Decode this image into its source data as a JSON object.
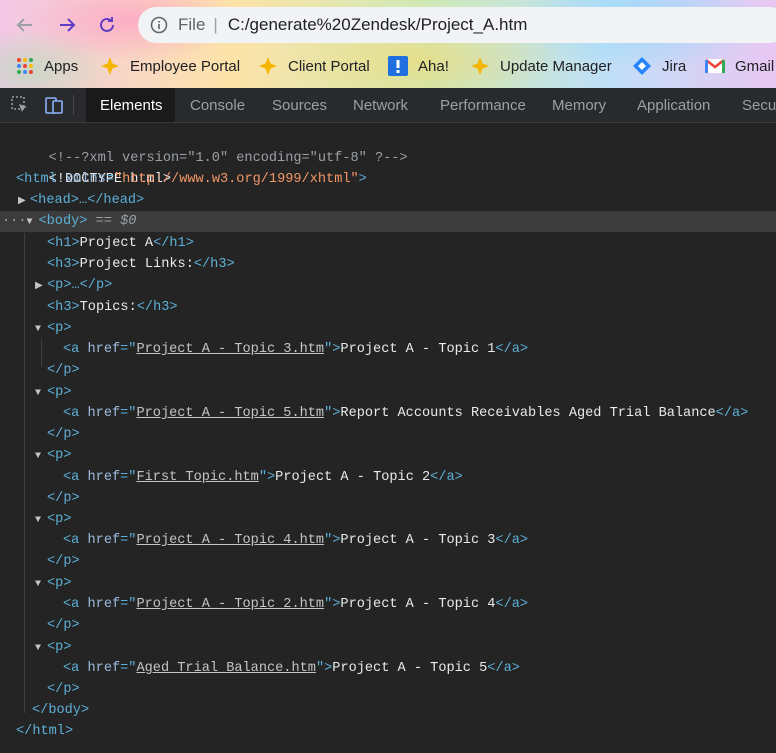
{
  "browser": {
    "address": {
      "scheme_label": "File",
      "url": "C:/generate%20Zendesk/Project_A.htm"
    },
    "bookmarks": [
      {
        "label": "Apps",
        "icon": "apps-grid-icon"
      },
      {
        "label": "Employee Portal",
        "icon": "star-diamond-icon"
      },
      {
        "label": "Client Portal",
        "icon": "star-diamond-icon"
      },
      {
        "label": "Aha!",
        "icon": "aha-icon"
      },
      {
        "label": "Update Manager",
        "icon": "star-diamond-icon"
      },
      {
        "label": "Jira",
        "icon": "jira-icon"
      },
      {
        "label": "Gmail",
        "icon": "gmail-icon"
      }
    ]
  },
  "devtools": {
    "tabs": [
      "Elements",
      "Console",
      "Sources",
      "Network",
      "Performance",
      "Memory",
      "Application",
      "Secu"
    ],
    "active_tab": "Elements",
    "dom": {
      "comment": "<!--?xml version=\"1.0\" encoding=\"utf-8\" ?-->",
      "doctype": "<!DOCTYPE html>",
      "html_open": {
        "tag": "<html",
        "attr": "xmlns",
        "value": "\"http://www.w3.org/1999/xhtml\"",
        "close": ">"
      },
      "head": "<head>…</head>",
      "body_open": "<body>",
      "body_marker": "== $0",
      "h1": {
        "open": "<h1>",
        "text": "Project A",
        "close": "</h1>"
      },
      "h3_links": {
        "open": "<h3>",
        "text": "Project Links:",
        "close": "</h3>"
      },
      "p_collapsed": "<p>…</p>",
      "h3_topics": {
        "open": "<h3>",
        "text": "Topics:",
        "close": "</h3>"
      },
      "p_open": "<p>",
      "p_close": "</p>",
      "a_open": "<a",
      "a_attr": "href",
      "a_close": "</a>",
      "links": [
        {
          "href": "Project_A_-_Topic_3.htm",
          "text": "Project A - Topic 1"
        },
        {
          "href": "Project_A_-_Topic_5.htm",
          "text": "Report Accounts Receivables Aged Trial Balance"
        },
        {
          "href": "First_Topic.htm",
          "text": "Project A - Topic 2"
        },
        {
          "href": "Project_A_-_Topic_4.htm",
          "text": "Project A - Topic 3"
        },
        {
          "href": "Project_A_-_Topic_2.htm",
          "text": "Project A - Topic 4"
        },
        {
          "href": "Aged_Trial_Balance.htm",
          "text": "Project A - Topic 5"
        }
      ],
      "body_close": "</body>",
      "html_close": "</html>"
    }
  },
  "colors": {
    "tag": "#5db0d7",
    "attr_name": "#9bbbdc",
    "attr_value": "#f29766",
    "panel_bg": "#242424"
  }
}
